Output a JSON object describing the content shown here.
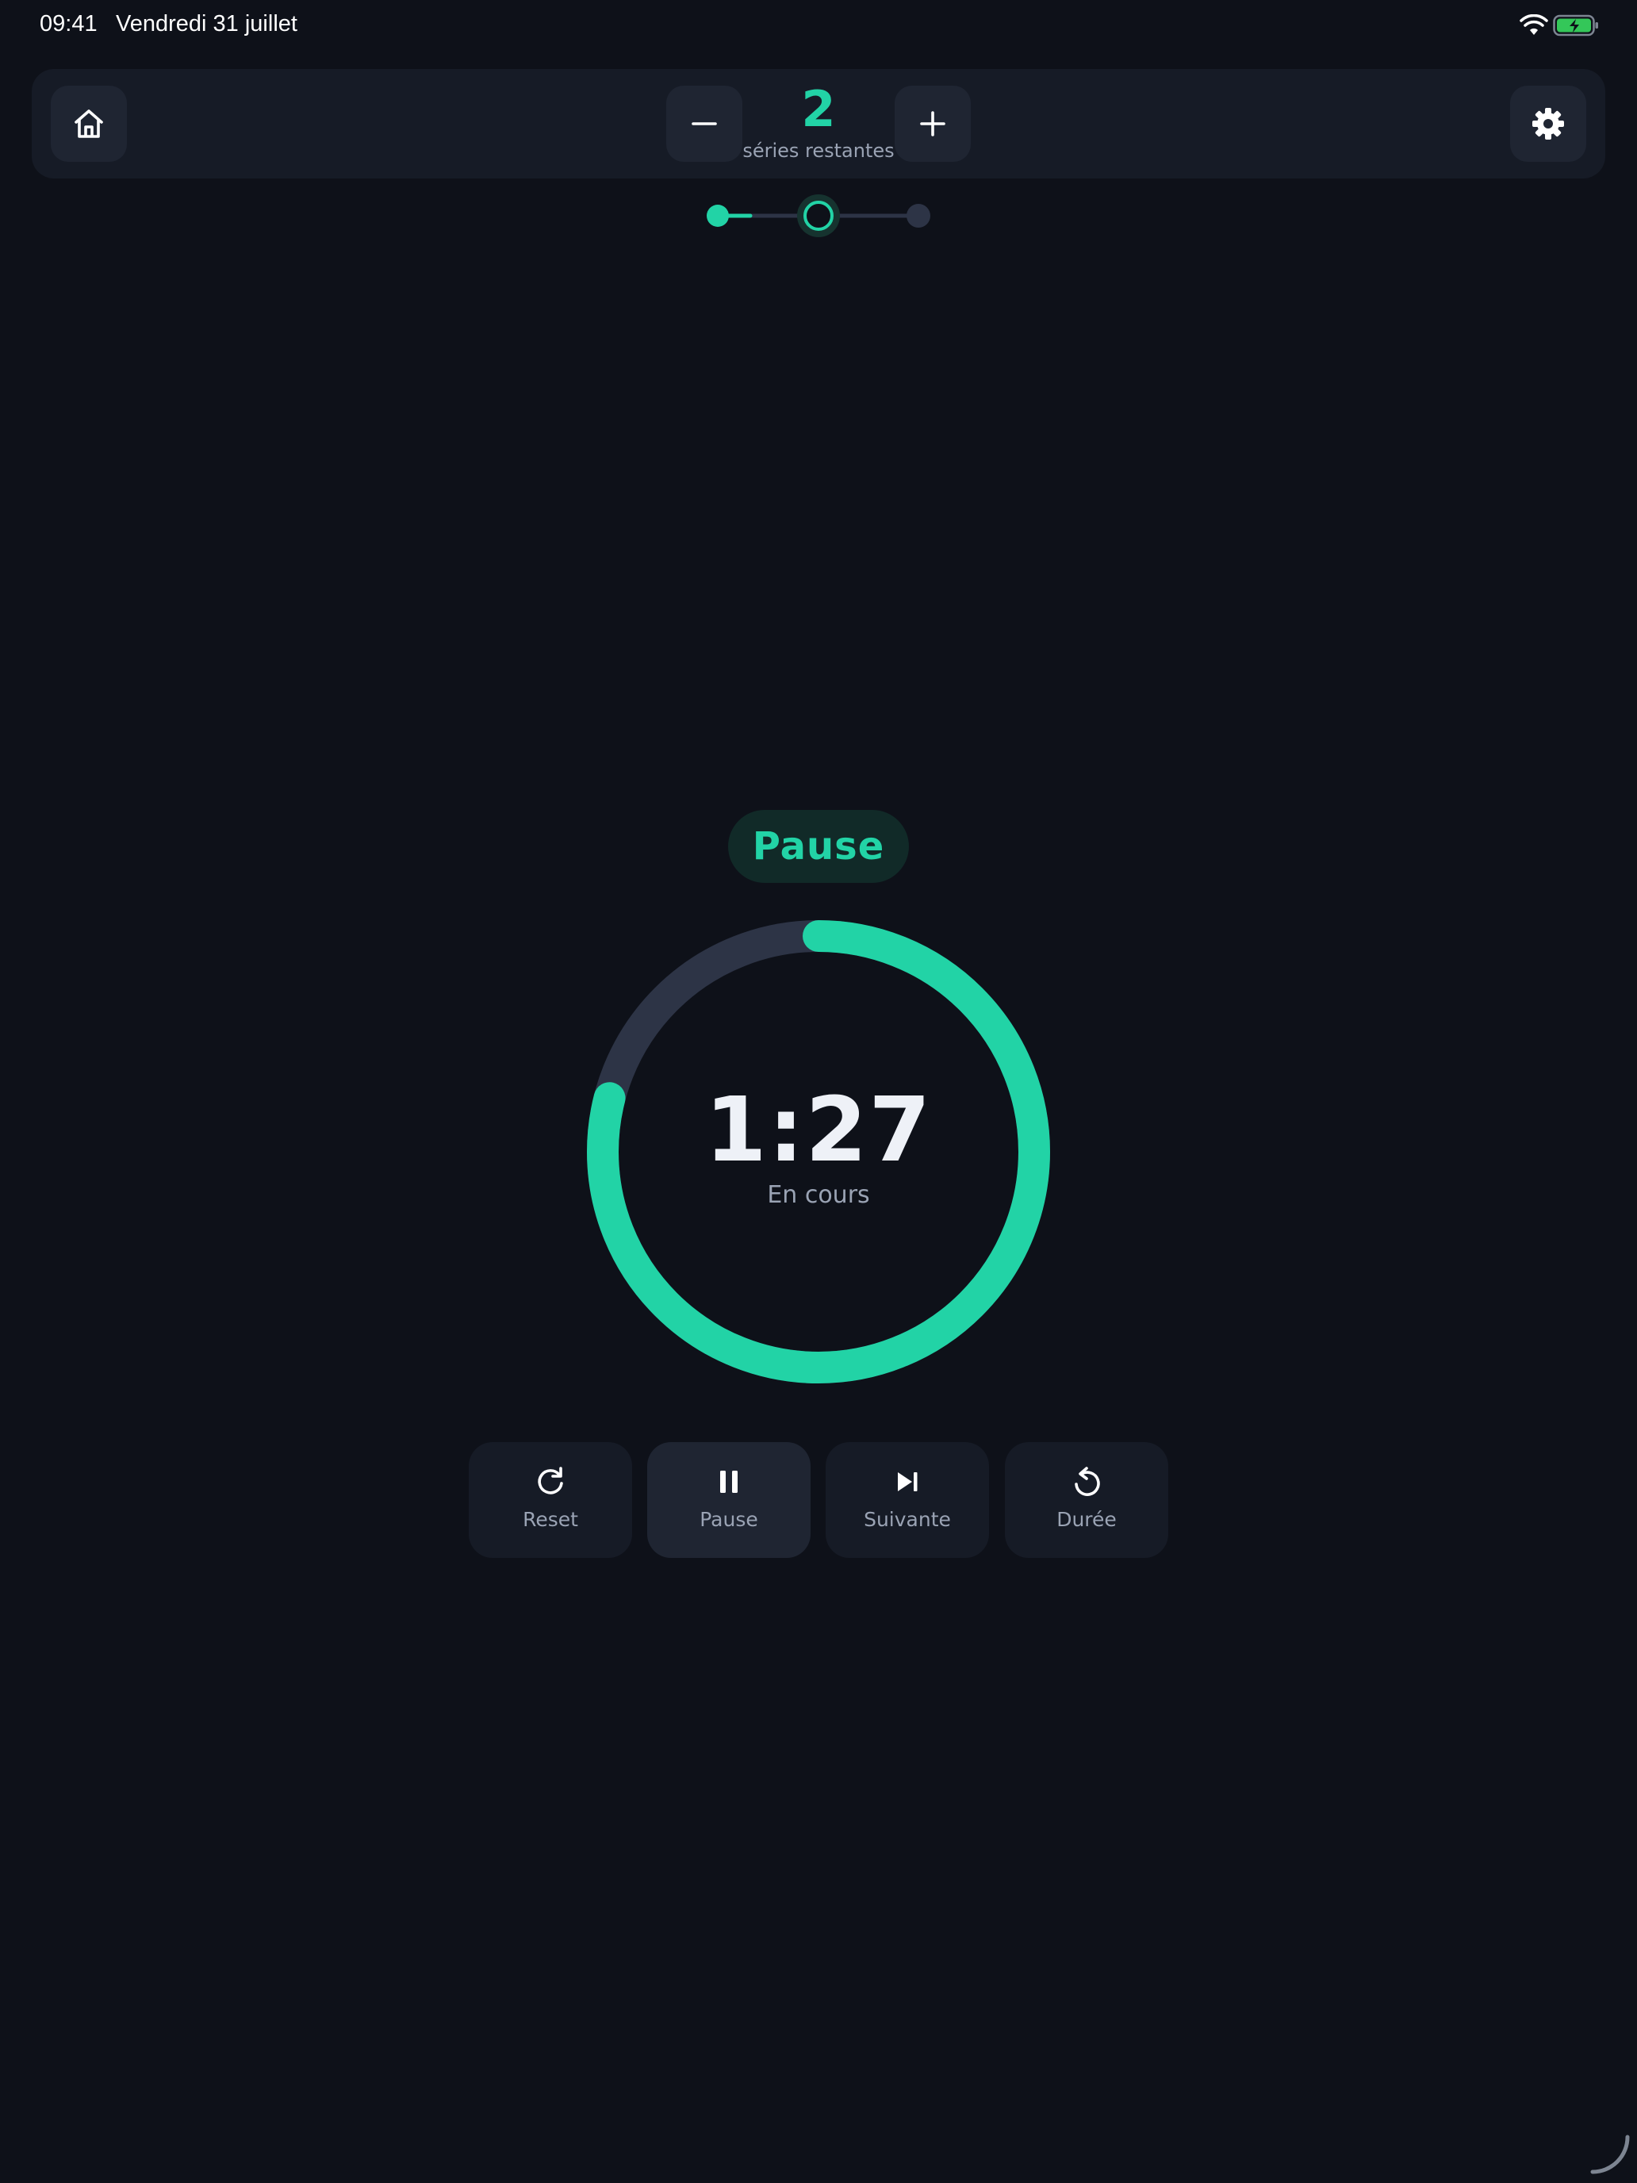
{
  "status_bar": {
    "time": "09:41",
    "date": "Vendredi 31 juillet",
    "wifi_icon": "wifi-icon",
    "battery_icon": "battery-charging-icon"
  },
  "toolbar": {
    "home_icon": "home-icon",
    "minus_icon": "minus-icon",
    "plus_icon": "plus-icon",
    "settings_icon": "gear-icon",
    "series_count": "2",
    "series_label": "séries restantes"
  },
  "stepper": {
    "total_steps": 3,
    "current_step": 2,
    "completed_steps": 1
  },
  "timer": {
    "phase": "Pause",
    "time": "1:27",
    "status": "En cours",
    "progress_remaining": 0.79
  },
  "controls": {
    "reset": {
      "label": "Reset",
      "icon": "refresh-icon"
    },
    "pause": {
      "label": "Pause",
      "icon": "pause-icon"
    },
    "next": {
      "label": "Suivante",
      "icon": "skip-next-icon"
    },
    "duration": {
      "label": "Durée",
      "icon": "undo-icon"
    }
  },
  "colors": {
    "background": "#0e1119",
    "panel": "#161b26",
    "button": "#1f2532",
    "accent": "#22d3a6",
    "track": "#2d3446",
    "text_secondary": "#9aa3b4"
  }
}
